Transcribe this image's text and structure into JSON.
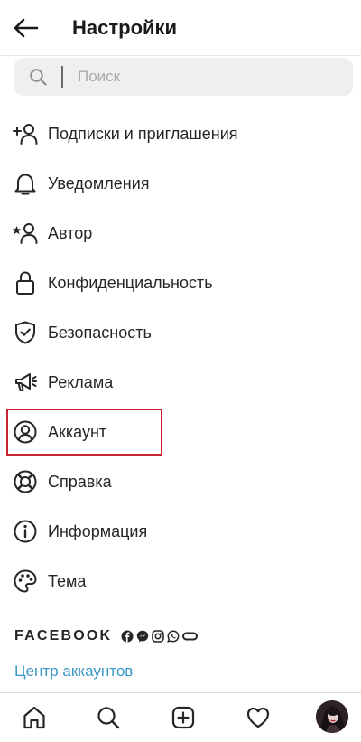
{
  "header": {
    "title": "Настройки"
  },
  "search": {
    "placeholder": "Поиск"
  },
  "menu": {
    "items": [
      {
        "label": "Подписки и приглашения",
        "icon": "add-person-icon"
      },
      {
        "label": "Уведомления",
        "icon": "bell-icon"
      },
      {
        "label": "Автор",
        "icon": "star-person-icon"
      },
      {
        "label": "Конфиденциальность",
        "icon": "lock-icon"
      },
      {
        "label": "Безопасность",
        "icon": "shield-icon"
      },
      {
        "label": "Реклама",
        "icon": "megaphone-icon"
      },
      {
        "label": "Аккаунт",
        "icon": "account-circle-icon",
        "highlighted": true
      },
      {
        "label": "Справка",
        "icon": "lifebuoy-icon"
      },
      {
        "label": "Информация",
        "icon": "info-icon"
      },
      {
        "label": "Тема",
        "icon": "palette-icon"
      }
    ]
  },
  "facebook": {
    "label": "FACEBOOK",
    "icons": [
      "facebook-icon",
      "messenger-icon",
      "instagram-icon",
      "whatsapp-icon",
      "portal-icon"
    ],
    "accounts_center": "Центр аккаунтов"
  },
  "bottom_nav": {
    "items": [
      "home-icon",
      "search-icon",
      "new-post-icon",
      "activity-heart-icon",
      "profile-avatar"
    ]
  },
  "colors": {
    "text": "#262626",
    "link": "#3897c4",
    "highlight_border": "#c8222c",
    "search_bg": "#efefef"
  }
}
